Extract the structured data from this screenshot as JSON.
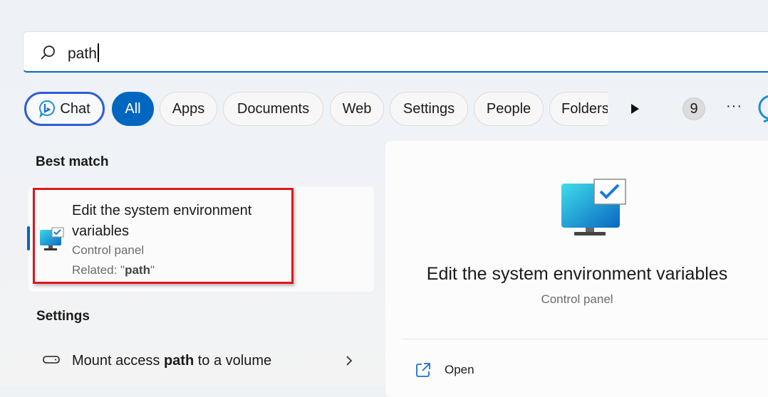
{
  "search": {
    "query": "path",
    "icon": "search-icon"
  },
  "filters": {
    "chat": "Chat",
    "items": [
      "All",
      "Apps",
      "Documents",
      "Web",
      "Settings",
      "People",
      "Folders"
    ],
    "active": "All",
    "count_badge": "9"
  },
  "best_match": {
    "heading": "Best match",
    "title_line1": "Edit the system environment",
    "title_line2": "variables",
    "type": "Control panel",
    "related_prefix": "Related: \"",
    "related_term": "path",
    "related_suffix": "\""
  },
  "settings": {
    "heading": "Settings",
    "item": {
      "pre": "Mount access ",
      "bold": "path",
      "post": " to a volume"
    }
  },
  "preview": {
    "title": "Edit the system environment variables",
    "subtitle": "Control panel",
    "actions": [
      {
        "label": "Open",
        "icon": "open-external-icon"
      }
    ]
  },
  "colors": {
    "accent": "#0067c0",
    "highlight": "#e0141b"
  }
}
